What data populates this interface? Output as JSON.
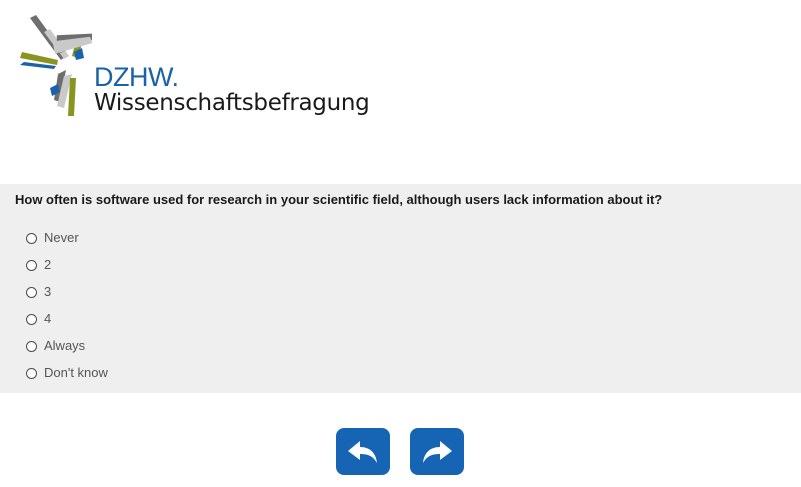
{
  "logo": {
    "abbreviation": "DZHW.",
    "wordmark": "Wissenschaftsbefragung"
  },
  "question": {
    "text": "How often is software used for research in your scientific field, although users lack information about it?",
    "options": [
      {
        "label": "Never"
      },
      {
        "label": "2"
      },
      {
        "label": "3"
      },
      {
        "label": "4"
      },
      {
        "label": "Always"
      },
      {
        "label": "Don't know"
      }
    ]
  },
  "navigation": {
    "back_icon": "back-arrow-icon",
    "next_icon": "forward-arrow-icon"
  },
  "colors": {
    "accent": "#1565b4",
    "panel_bg": "#efefef",
    "logo_blue": "#1b63a8",
    "logo_olive": "#8a9520",
    "logo_gray": "#6e6e6e"
  }
}
